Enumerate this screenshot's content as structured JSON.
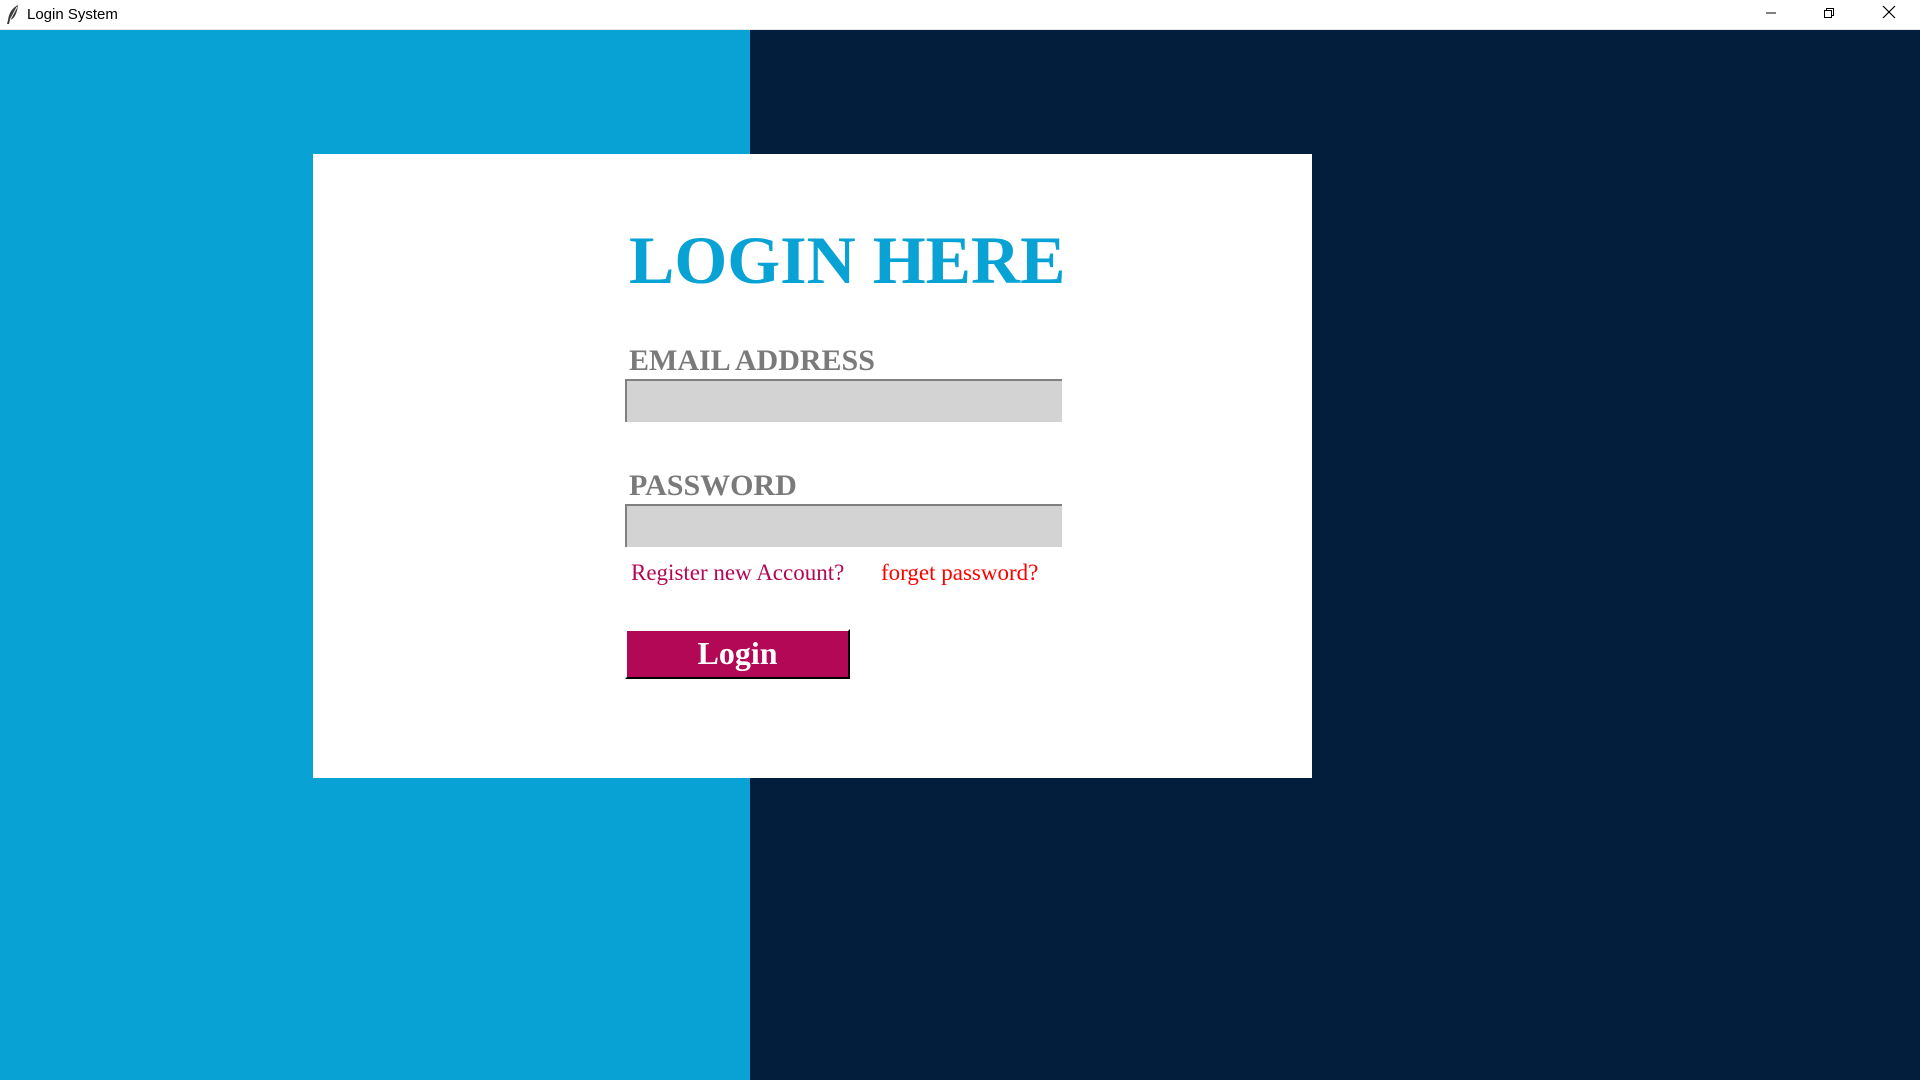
{
  "window": {
    "title": "Login System"
  },
  "colors": {
    "left_panel": "#08a3d4",
    "right_panel": "#031e3c",
    "heading": "#08a3d4",
    "link_register": "#b30855",
    "link_forgot": "#ff0000",
    "login_button": "#b30855"
  },
  "icons": {
    "app": "feather-icon",
    "minimize": "minimize-icon",
    "maximize": "restore-icon",
    "close": "close-icon"
  },
  "login": {
    "heading": "LOGIN HERE",
    "email_label": "EMAIL ADDRESS",
    "email_value": "",
    "password_label": "PASSWORD",
    "password_value": "",
    "register_link": "Register new Account?",
    "forgot_link": "forget password?",
    "login_button": "Login"
  }
}
